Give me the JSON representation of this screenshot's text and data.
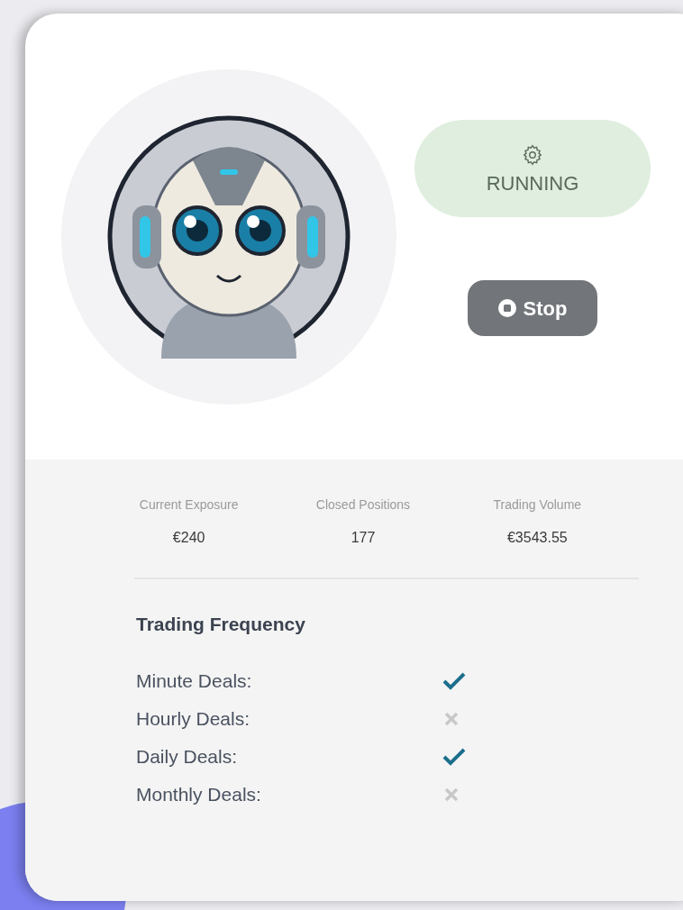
{
  "status": {
    "label": "RUNNING",
    "running": true
  },
  "stop_button": {
    "label": "Stop"
  },
  "stats": [
    {
      "label": "Current Exposure",
      "value": "€240"
    },
    {
      "label": "Closed Positions",
      "value": "177"
    },
    {
      "label": "Trading Volume",
      "value": "€3543.55"
    }
  ],
  "frequency": {
    "title": "Trading Frequency",
    "items": [
      {
        "label": "Minute Deals:",
        "checked": true
      },
      {
        "label": "Hourly Deals:",
        "checked": false
      },
      {
        "label": "Daily Deals:",
        "checked": true
      },
      {
        "label": "Monthly Deals:",
        "checked": false
      }
    ]
  }
}
